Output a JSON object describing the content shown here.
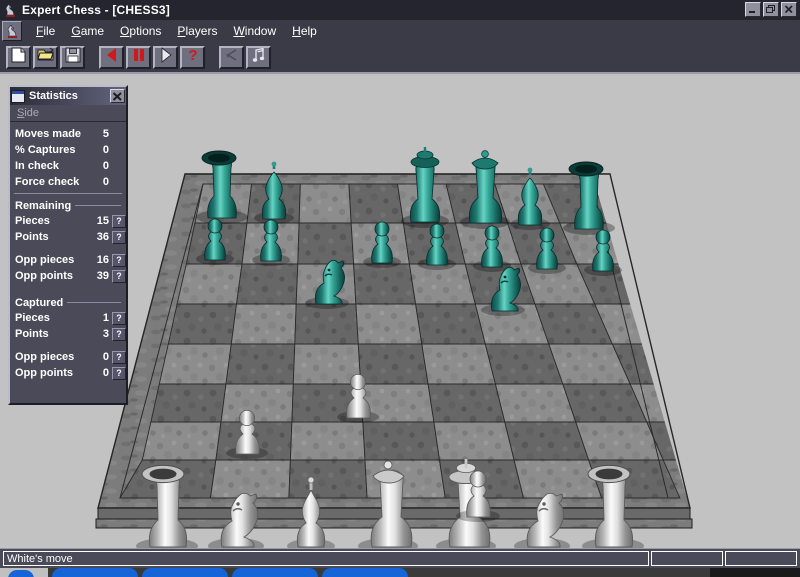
{
  "window": {
    "title": "Expert Chess - [CHESS3]",
    "app_icon": "knight-chess-piece-icon",
    "controls": {
      "minimize": "minimize-icon",
      "restore": "restore-icon",
      "close": "close-icon"
    }
  },
  "menubar": {
    "doc_icon": "mdi-document-icon",
    "items": [
      {
        "label": "File",
        "accel": "F"
      },
      {
        "label": "Game",
        "accel": "G"
      },
      {
        "label": "Options",
        "accel": "O"
      },
      {
        "label": "Players",
        "accel": "P"
      },
      {
        "label": "Window",
        "accel": "W"
      },
      {
        "label": "Help",
        "accel": "H"
      }
    ]
  },
  "toolbar": {
    "buttons": [
      {
        "name": "new-game-button",
        "icon": "new-document-icon",
        "tooltip": "New"
      },
      {
        "name": "open-game-button",
        "icon": "open-folder-icon",
        "tooltip": "Open"
      },
      {
        "name": "save-game-button",
        "icon": "floppy-disk-save-icon",
        "tooltip": "Save"
      },
      {
        "name": "step-back-button",
        "icon": "red-back-triangle-icon",
        "tooltip": "Back"
      },
      {
        "name": "pause-button",
        "icon": "red-pause-icon",
        "tooltip": "Pause"
      },
      {
        "name": "step-forward-button",
        "icon": "forward-triangle-icon",
        "tooltip": "Forward"
      },
      {
        "name": "hint-button",
        "icon": "red-question-mark-icon",
        "tooltip": "Hint"
      },
      {
        "name": "move-list-button",
        "icon": "move-arrow-icon",
        "tooltip": "Moves"
      },
      {
        "name": "sound-button",
        "icon": "music-note-icon",
        "tooltip": "Sound"
      }
    ]
  },
  "statistics_window": {
    "icon": "mdi-window-icon",
    "title": "Statistics",
    "close_label": "✕",
    "menu": [
      {
        "label": "Side",
        "accel": "S"
      }
    ],
    "top_rows": [
      {
        "label": "Moves made",
        "value": "5"
      },
      {
        "label": "% Captures",
        "value": "0"
      },
      {
        "label": "In check",
        "value": "0"
      },
      {
        "label": "Force check",
        "value": "0"
      }
    ],
    "sections": [
      {
        "header": "Remaining",
        "group_a": [
          {
            "label": "Pieces",
            "value": "15",
            "help": "?"
          },
          {
            "label": "Points",
            "value": "36",
            "help": "?"
          }
        ],
        "group_b": [
          {
            "label": "Opp pieces",
            "value": "16",
            "help": "?"
          },
          {
            "label": "Opp points",
            "value": "39",
            "help": "?"
          }
        ]
      },
      {
        "header": "Captured",
        "group_a": [
          {
            "label": "Pieces",
            "value": "1",
            "help": "?"
          },
          {
            "label": "Points",
            "value": "3",
            "help": "?"
          }
        ],
        "group_b": [
          {
            "label": "Opp pieces",
            "value": "0",
            "help": "?"
          },
          {
            "label": "Opp points",
            "value": "0",
            "help": "?"
          }
        ]
      }
    ]
  },
  "statusbar": {
    "message": "White's move",
    "pane2": "",
    "pane3": ""
  },
  "board": {
    "view": "3d-perspective",
    "files": 8,
    "ranks": 8,
    "light_square_color": "#9b9b9b",
    "dark_square_color": "#6e6e6e",
    "frame_color": "#8a8a8a",
    "background_color": "#c2c2c2",
    "white_piece_color": "#d9d9d9",
    "black_piece_color": "#2f9e92",
    "pieces": [
      {
        "square": "a8",
        "color": "black",
        "type": "rook"
      },
      {
        "square": "c8",
        "color": "black",
        "type": "bishop"
      },
      {
        "square": "e8",
        "color": "black",
        "type": "king"
      },
      {
        "square": "f8",
        "color": "black",
        "type": "queen"
      },
      {
        "square": "h8",
        "color": "black",
        "type": "rook"
      },
      {
        "square": "g8",
        "color": "black",
        "type": "bishop"
      },
      {
        "square": "a7",
        "color": "black",
        "type": "pawn"
      },
      {
        "square": "b7",
        "color": "black",
        "type": "pawn"
      },
      {
        "square": "d7",
        "color": "black",
        "type": "pawn"
      },
      {
        "square": "e7",
        "color": "black",
        "type": "pawn"
      },
      {
        "square": "f7",
        "color": "black",
        "type": "pawn"
      },
      {
        "square": "g7",
        "color": "black",
        "type": "pawn"
      },
      {
        "square": "h7",
        "color": "black",
        "type": "pawn"
      },
      {
        "square": "c6",
        "color": "black",
        "type": "knight"
      },
      {
        "square": "f6",
        "color": "black",
        "type": "knight"
      },
      {
        "square": "d4",
        "color": "white",
        "type": "pawn"
      },
      {
        "square": "c3",
        "color": "white",
        "type": "pawn"
      },
      {
        "square": "a1",
        "color": "white",
        "type": "rook"
      },
      {
        "square": "b1",
        "color": "white",
        "type": "knight"
      },
      {
        "square": "c1",
        "color": "white",
        "type": "bishop"
      },
      {
        "square": "d1",
        "color": "white",
        "type": "queen"
      },
      {
        "square": "e1",
        "color": "white",
        "type": "king"
      },
      {
        "square": "f1",
        "color": "white",
        "type": "pawn"
      },
      {
        "square": "g1",
        "color": "white",
        "type": "knight"
      },
      {
        "square": "h1",
        "color": "white",
        "type": "rook"
      }
    ]
  },
  "taskbar": {
    "start_label": "",
    "tasks": [
      "",
      "",
      "",
      ""
    ]
  }
}
